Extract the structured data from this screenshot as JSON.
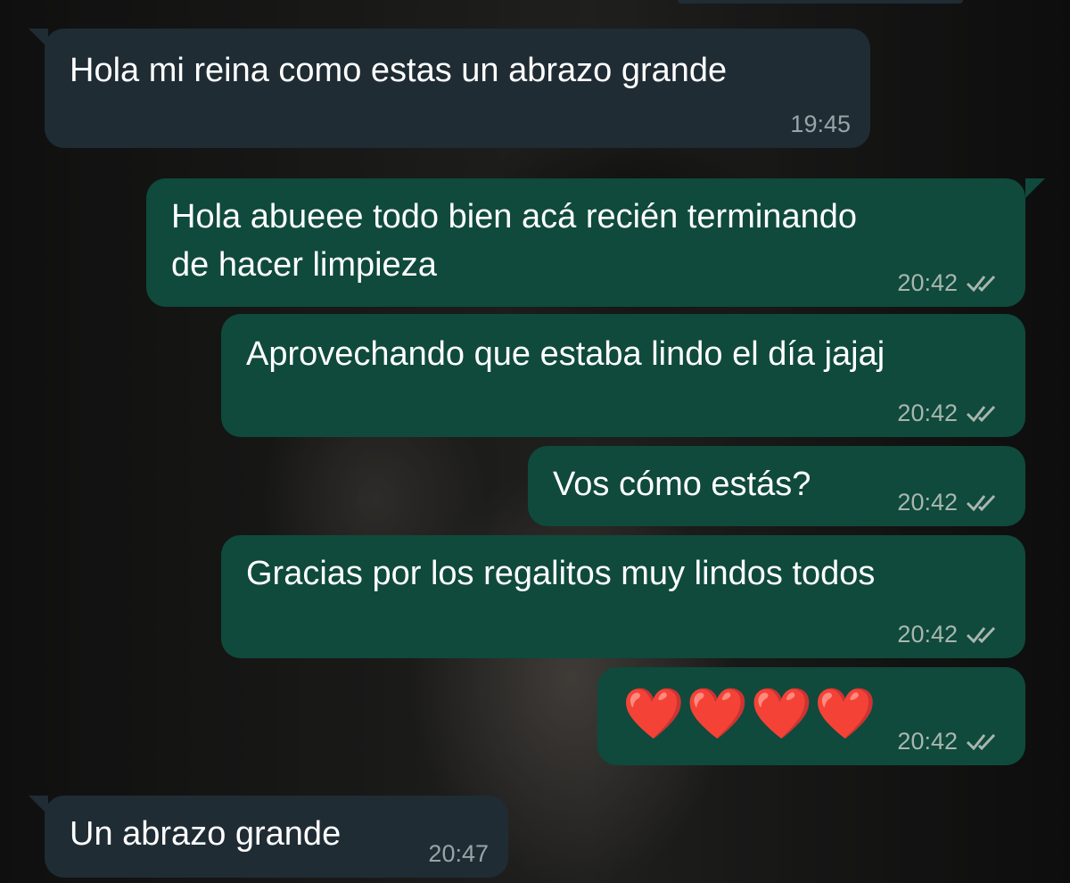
{
  "messages": [
    {
      "direction": "incoming",
      "text": "Hola mi reina como estas un abrazo grande",
      "time": "19:45"
    },
    {
      "direction": "outgoing",
      "text": "Hola abueee todo bien acá recién terminando\nde hacer limpieza",
      "time": "20:42",
      "status_icon": "double-check-icon"
    },
    {
      "direction": "outgoing",
      "text": "Aprovechando que estaba lindo el día jajaj",
      "time": "20:42",
      "status_icon": "double-check-icon"
    },
    {
      "direction": "outgoing",
      "text": "Vos cómo estás?",
      "time": "20:42",
      "status_icon": "double-check-icon"
    },
    {
      "direction": "outgoing",
      "text": "Gracias por los regalitos muy lindos todos",
      "time": "20:42",
      "status_icon": "double-check-icon"
    },
    {
      "direction": "outgoing",
      "text": "❤️❤️❤️❤️",
      "time": "20:42",
      "status_icon": "double-check-icon"
    },
    {
      "direction": "incoming",
      "text": "Un abrazo grande",
      "time": "20:47"
    }
  ],
  "colors": {
    "incoming_bubble": "#1f2c34",
    "outgoing_bubble": "#0f4a3c",
    "text": "#ffffff",
    "timestamp": "#a9b6ae",
    "heart": "#ff2a3d"
  }
}
